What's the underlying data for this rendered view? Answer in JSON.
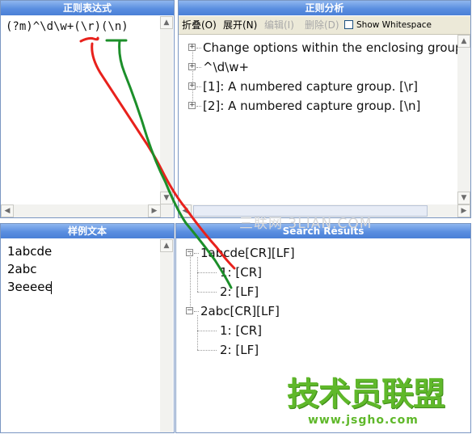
{
  "regex_panel": {
    "title": "正则表达式",
    "pattern": "(?m)^\\d\\w+(\\r)(\\n)"
  },
  "analysis_panel": {
    "title": "正则分析",
    "toolbar": {
      "collapse": "折叠(O)",
      "expand": "展开(N)",
      "edit": "编辑(I)",
      "delete": "删除(D)",
      "show_whitespace": "Show Whitespace"
    },
    "tree": [
      "Change options within the enclosing group",
      "^\\d\\w+",
      "[1]: A numbered capture group. [\\r]",
      "[2]: A numbered capture group. [\\n]"
    ]
  },
  "sample_panel": {
    "title": "样例文本",
    "lines": [
      "1abcde",
      "2abc",
      "3eeeee"
    ]
  },
  "results_panel": {
    "title": "Search Results",
    "matches": [
      {
        "label": "1abcde[CR][LF]",
        "groups": [
          "1: [CR]",
          "2: [LF]"
        ]
      },
      {
        "label": "2abc[CR][LF]",
        "groups": [
          "1: [CR]",
          "2: [LF]"
        ]
      }
    ]
  },
  "watermarks": {
    "center": "三联网 3LIAN.COM",
    "logo_main": "技术员联盟",
    "logo_url": "www.jsgho.com"
  },
  "colors": {
    "titlebar": "#5a8ee0",
    "red_annotation": "#e8211c",
    "green_annotation": "#1c8f2a",
    "logo_green": "#5fb82a"
  }
}
